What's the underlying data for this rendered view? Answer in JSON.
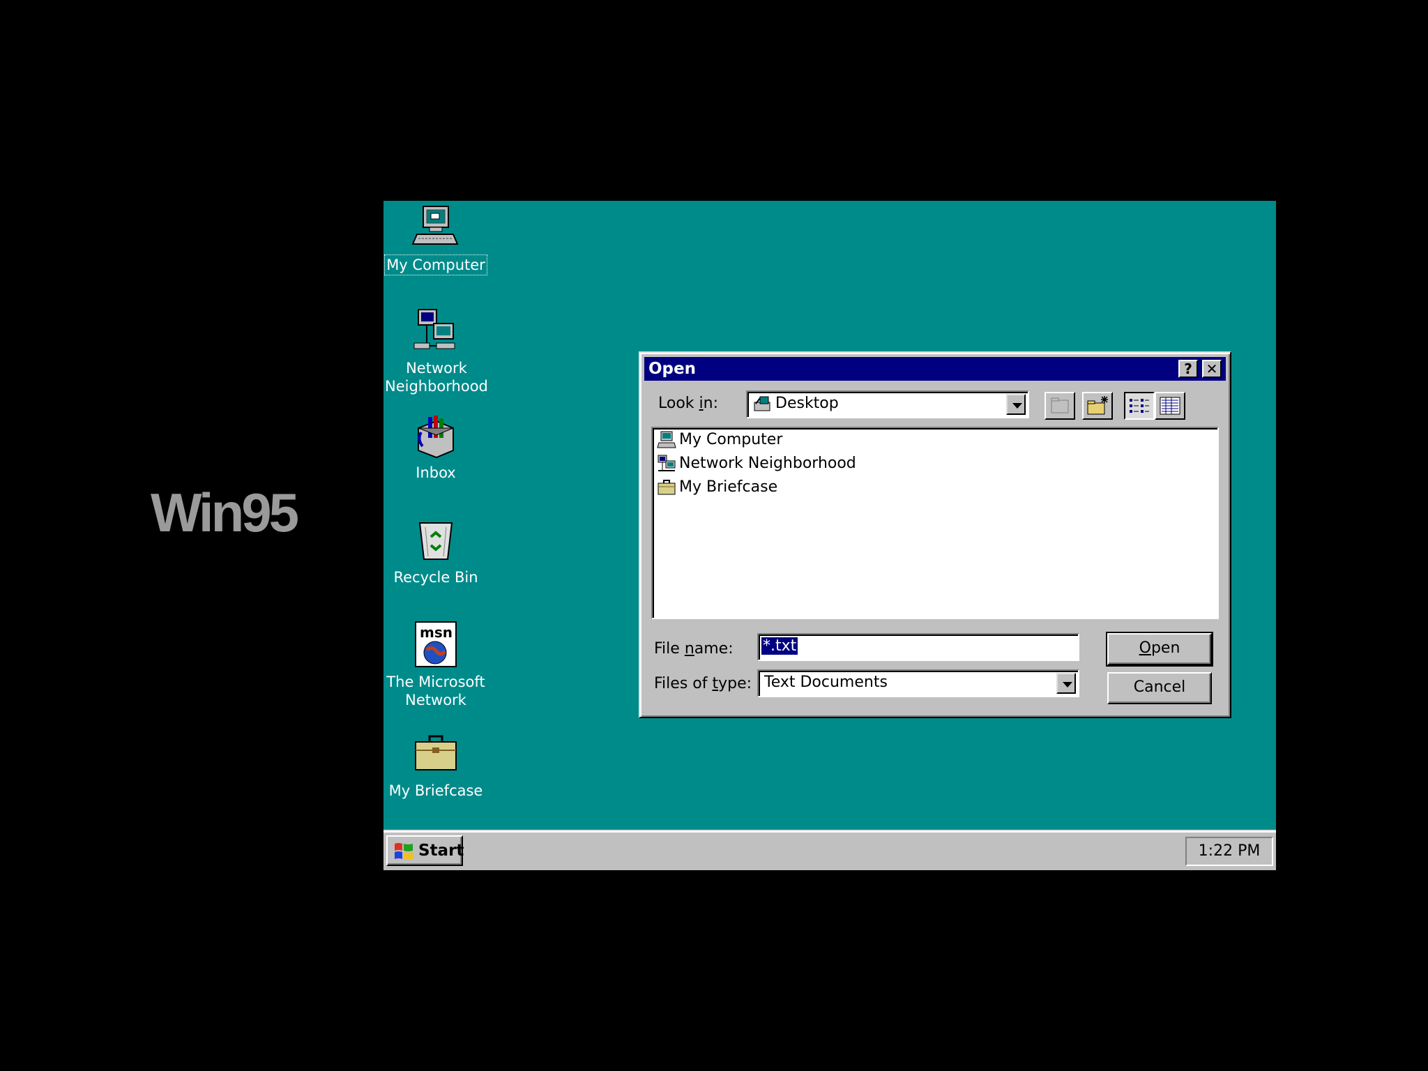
{
  "caption": "Win95",
  "desktop": {
    "background": "#008b8b",
    "icons": [
      {
        "label": "My Computer",
        "icon": "computer-icon"
      },
      {
        "label": "Network\nNeighborhood",
        "icon": "network-icon"
      },
      {
        "label": "Inbox",
        "icon": "inbox-icon"
      },
      {
        "label": "Recycle Bin",
        "icon": "recycle-bin-icon"
      },
      {
        "label": "The Microsoft\nNetwork",
        "icon": "msn-icon"
      },
      {
        "label": "My Briefcase",
        "icon": "briefcase-icon"
      }
    ]
  },
  "dialog": {
    "title": "Open",
    "help_button": "?",
    "close_button": "✕",
    "look_in_label_pre": "Look ",
    "look_in_label_mn": "i",
    "look_in_label_post": "n:",
    "look_in_value": "Desktop",
    "files": [
      {
        "name": "My Computer",
        "icon": "computer-icon"
      },
      {
        "name": "Network Neighborhood",
        "icon": "network-icon"
      },
      {
        "name": "My Briefcase",
        "icon": "briefcase-icon"
      }
    ],
    "file_name_label_pre": "File ",
    "file_name_label_mn": "n",
    "file_name_label_post": "ame:",
    "file_name_value": "*.txt",
    "file_type_label_pre": "Files of ",
    "file_type_label_mn": "t",
    "file_type_label_post": "ype:",
    "file_type_value": "Text Documents",
    "open_button_mn": "O",
    "open_button_rest": "pen",
    "cancel_button": "Cancel"
  },
  "taskbar": {
    "start_label": "Start",
    "clock": "1:22 PM"
  },
  "colors": {
    "titlebar": "#000080",
    "face": "#c0c0c0"
  }
}
